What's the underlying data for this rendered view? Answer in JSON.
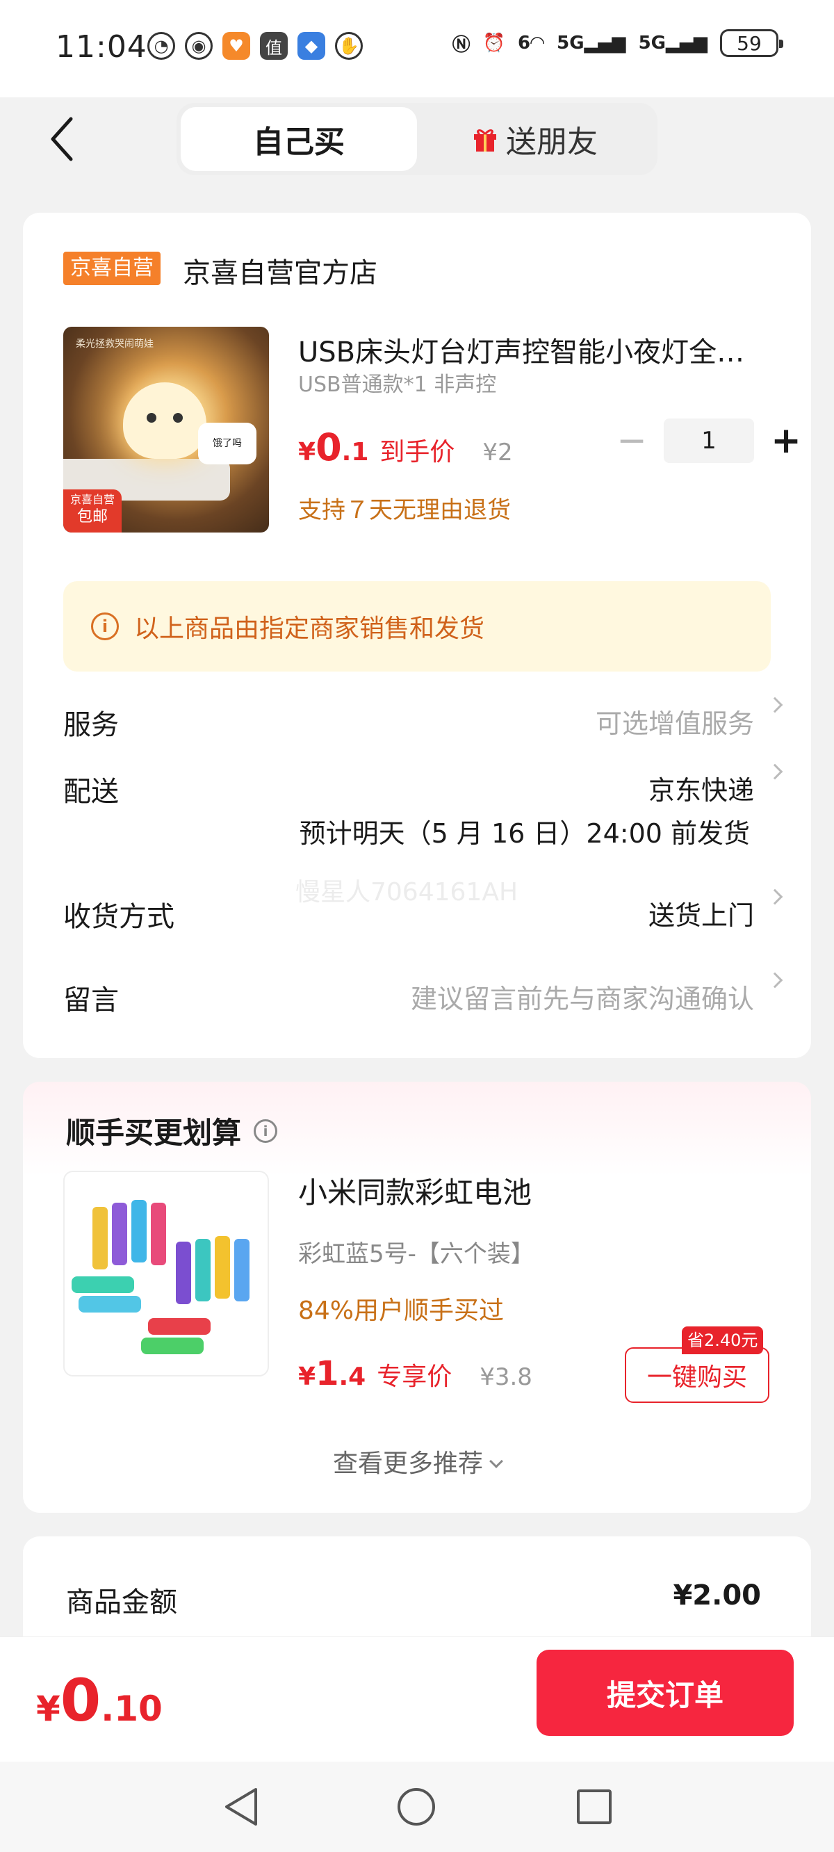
{
  "status_bar": {
    "time": "11:04",
    "signal_1": "6",
    "signal_2": "5G",
    "signal_3": "5G",
    "battery": "59"
  },
  "nav": {
    "tab_self": "自己买",
    "tab_gift": "送朋友"
  },
  "order": {
    "store_badge": "京喜自营",
    "store_name": "京喜自营官方店",
    "product": {
      "title": "USB床头灯台灯声控智能小夜灯全…",
      "spec": "USB普通款*1 非声控",
      "price_currency": "¥",
      "price_int": "0",
      "price_dec": ".1",
      "price_label": "到手价",
      "original_price": "¥2",
      "quantity": "1",
      "return_policy": "支持７天无理由退货",
      "image_corner_line1": "京喜自营",
      "image_corner_line2": "包邮",
      "image_top_text": "柔光拯救哭闹萌娃",
      "image_bubble": "饿了吗"
    },
    "notice": "以上商品由指定商家销售和发货",
    "rows": {
      "service_label": "服务",
      "service_value": "可选增值服务",
      "delivery_label": "配送",
      "delivery_value": "京东快递",
      "delivery_eta": "预计明天（5 月 16 日）24:00 前发货",
      "receive_label": "收货方式",
      "receive_value": "送货上门",
      "message_label": "留言",
      "message_placeholder": "建议留言前先与商家沟通确认"
    },
    "watermark": "慢星人7064161AH"
  },
  "recommend": {
    "title": "顺手买更划算",
    "item": {
      "name": "小米同款彩虹电池",
      "spec": "彩虹蓝5号-【六个装】",
      "bought_pct": "84%用户顺手买过",
      "price_currency": "¥",
      "price_int": "1",
      "price_dec": ".4",
      "price_label": "专享价",
      "original_price": "¥3.8",
      "save_tag": "省2.40元",
      "buy_button": "一键购买"
    },
    "more": "查看更多推荐"
  },
  "summary": {
    "goods_amount_label": "商品金额",
    "goods_amount_value": "¥2.00"
  },
  "bottom": {
    "total_currency": "¥",
    "total_int": "0",
    "total_dec": ".10",
    "submit": "提交订单"
  },
  "colors": {
    "accent_red": "#e8232b",
    "submit_red": "#f6263f",
    "orange_text": "#c87017",
    "store_badge": "#f5802a",
    "notice_bg": "#fff8df"
  }
}
